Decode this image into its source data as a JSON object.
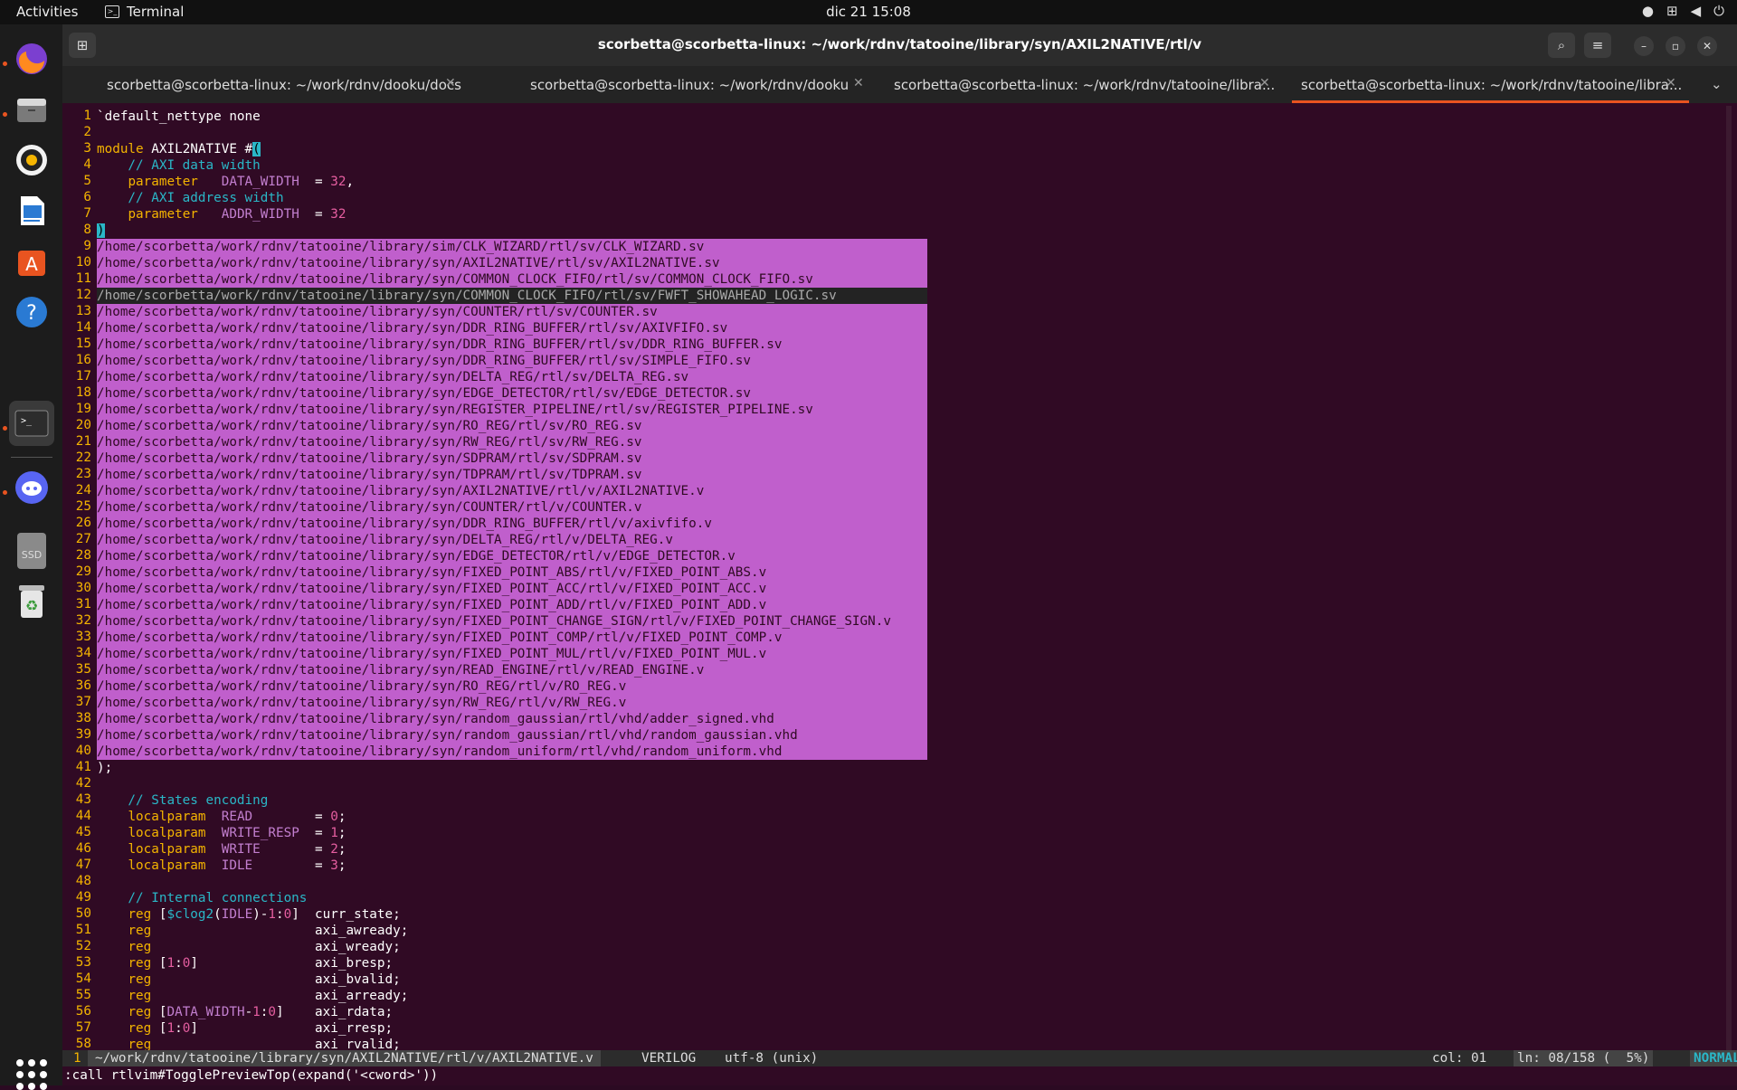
{
  "topbar": {
    "activities": "Activities",
    "app_name": "Terminal",
    "clock": "dic 21  15:08"
  },
  "dock": {
    "items": [
      {
        "icon": "firefox-icon"
      },
      {
        "icon": "files-icon"
      },
      {
        "icon": "rhythmbox-icon"
      },
      {
        "icon": "writer-icon"
      },
      {
        "icon": "software-center-icon"
      },
      {
        "icon": "help-icon"
      },
      {
        "icon": "terminal-icon"
      },
      {
        "icon": "discord-icon"
      },
      {
        "icon": "ssd-icon",
        "label": "SSD"
      },
      {
        "icon": "trash-icon"
      }
    ]
  },
  "window": {
    "title": "scorbetta@scorbetta-linux: ~/work/rdnv/tatooine/library/syn/AXIL2NATIVE/rtl/v",
    "tabs": [
      {
        "label": "scorbetta@scorbetta-linux: ~/work/rdnv/dooku/docs"
      },
      {
        "label": "scorbetta@scorbetta-linux: ~/work/rdnv/dooku"
      },
      {
        "label": "scorbetta@scorbetta-linux: ~/work/rdnv/tatooine/libra..."
      },
      {
        "label": "scorbetta@scorbetta-linux: ~/work/rdnv/tatooine/libra..."
      }
    ]
  },
  "editor": {
    "lines": [
      "`default_nettype none",
      "",
      "module AXIL2NATIVE #(",
      "    // AXI data width",
      "    parameter   DATA_WIDTH  = 32,",
      "    // AXI address width",
      "    parameter   ADDR_WIDTH  = 32",
      ")",
      "/home/scorbetta/work/rdnv/tatooine/library/sim/CLK_WIZARD/rtl/sv/CLK_WIZARD.sv",
      "/home/scorbetta/work/rdnv/tatooine/library/syn/AXIL2NATIVE/rtl/sv/AXIL2NATIVE.sv",
      "/home/scorbetta/work/rdnv/tatooine/library/syn/COMMON_CLOCK_FIFO/rtl/sv/COMMON_CLOCK_FIFO.sv",
      "/home/scorbetta/work/rdnv/tatooine/library/syn/COMMON_CLOCK_FIFO/rtl/sv/FWFT_SHOWAHEAD_LOGIC.sv",
      "/home/scorbetta/work/rdnv/tatooine/library/syn/COUNTER/rtl/sv/COUNTER.sv",
      "/home/scorbetta/work/rdnv/tatooine/library/syn/DDR_RING_BUFFER/rtl/sv/AXIVFIFO.sv",
      "/home/scorbetta/work/rdnv/tatooine/library/syn/DDR_RING_BUFFER/rtl/sv/DDR_RING_BUFFER.sv",
      "/home/scorbetta/work/rdnv/tatooine/library/syn/DDR_RING_BUFFER/rtl/sv/SIMPLE_FIFO.sv",
      "/home/scorbetta/work/rdnv/tatooine/library/syn/DELTA_REG/rtl/sv/DELTA_REG.sv",
      "/home/scorbetta/work/rdnv/tatooine/library/syn/EDGE_DETECTOR/rtl/sv/EDGE_DETECTOR.sv",
      "/home/scorbetta/work/rdnv/tatooine/library/syn/REGISTER_PIPELINE/rtl/sv/REGISTER_PIPELINE.sv",
      "/home/scorbetta/work/rdnv/tatooine/library/syn/RO_REG/rtl/sv/RO_REG.sv",
      "/home/scorbetta/work/rdnv/tatooine/library/syn/RW_REG/rtl/sv/RW_REG.sv",
      "/home/scorbetta/work/rdnv/tatooine/library/syn/SDPRAM/rtl/sv/SDPRAM.sv",
      "/home/scorbetta/work/rdnv/tatooine/library/syn/TDPRAM/rtl/sv/TDPRAM.sv",
      "/home/scorbetta/work/rdnv/tatooine/library/syn/AXIL2NATIVE/rtl/v/AXIL2NATIVE.v",
      "/home/scorbetta/work/rdnv/tatooine/library/syn/COUNTER/rtl/v/COUNTER.v",
      "/home/scorbetta/work/rdnv/tatooine/library/syn/DDR_RING_BUFFER/rtl/v/axivfifo.v",
      "/home/scorbetta/work/rdnv/tatooine/library/syn/DELTA_REG/rtl/v/DELTA_REG.v",
      "/home/scorbetta/work/rdnv/tatooine/library/syn/EDGE_DETECTOR/rtl/v/EDGE_DETECTOR.v",
      "/home/scorbetta/work/rdnv/tatooine/library/syn/FIXED_POINT_ABS/rtl/v/FIXED_POINT_ABS.v",
      "/home/scorbetta/work/rdnv/tatooine/library/syn/FIXED_POINT_ACC/rtl/v/FIXED_POINT_ACC.v",
      "/home/scorbetta/work/rdnv/tatooine/library/syn/FIXED_POINT_ADD/rtl/v/FIXED_POINT_ADD.v",
      "/home/scorbetta/work/rdnv/tatooine/library/syn/FIXED_POINT_CHANGE_SIGN/rtl/v/FIXED_POINT_CHANGE_SIGN.v",
      "/home/scorbetta/work/rdnv/tatooine/library/syn/FIXED_POINT_COMP/rtl/v/FIXED_POINT_COMP.v",
      "/home/scorbetta/work/rdnv/tatooine/library/syn/FIXED_POINT_MUL/rtl/v/FIXED_POINT_MUL.v",
      "/home/scorbetta/work/rdnv/tatooine/library/syn/READ_ENGINE/rtl/v/READ_ENGINE.v",
      "/home/scorbetta/work/rdnv/tatooine/library/syn/RO_REG/rtl/v/RO_REG.v",
      "/home/scorbetta/work/rdnv/tatooine/library/syn/RW_REG/rtl/v/RW_REG.v",
      "/home/scorbetta/work/rdnv/tatooine/library/syn/random_gaussian/rtl/vhd/adder_signed.vhd",
      "/home/scorbetta/work/rdnv/tatooine/library/syn/random_gaussian/rtl/vhd/random_gaussian.vhd",
      "/home/scorbetta/work/rdnv/tatooine/library/syn/random_uniform/rtl/vhd/random_uniform.vhd",
      ");",
      "",
      "    // States encoding",
      "    localparam  READ        = 0;",
      "    localparam  WRITE_RESP  = 1;",
      "    localparam  WRITE       = 2;",
      "    localparam  IDLE        = 3;",
      "",
      "    // Internal connections",
      "    reg [$clog2(IDLE)-1:0]  curr_state;",
      "    reg                     axi_awready;",
      "    reg                     axi_wready;",
      "    reg [1:0]               axi_bresp;",
      "    reg                     axi_bvalid;",
      "    reg                     axi_arready;",
      "    reg [DATA_WIDTH-1:0]    axi_rdata;",
      "    reg [1:0]               axi_rresp;",
      "    reg                     axi_rvalid;"
    ]
  },
  "statusline": {
    "bufnr": "1",
    "path": "~/work/rdnv/tatooine/library/syn/AXIL2NATIVE/rtl/v/AXIL2NATIVE.v",
    "filetype": "VERILOG",
    "encoding": "utf-8 (unix)",
    "col": "col: 01",
    "ln": "ln: 08/158 (  5%)",
    "mode": "NORMAL"
  },
  "cmdline": ":call rtlvim#TogglePreviewTop(expand('<cword>'))",
  "colors": {
    "terminal_bg": "#300a24",
    "selection_bg": "#c05fcc",
    "line_number": "#f4b400",
    "accent_tab": "#e95420"
  }
}
